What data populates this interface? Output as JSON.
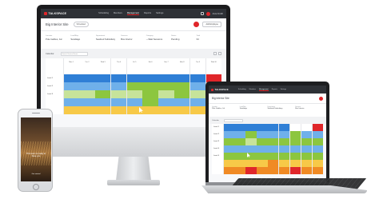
{
  "brand": {
    "accent": "#e0262a",
    "dark": "#2e3136",
    "logo_text": "TALKSPACE"
  },
  "imac": {
    "topbar": {
      "nav": [
        "Scheduling",
        "Members",
        "Management",
        "Reports",
        "Settings"
      ],
      "user": "Anna Smith"
    },
    "title": "Big Interior Site",
    "pill": "Scheduled",
    "cta_label": "Add Employee",
    "metrics": [
      {
        "label": "Location",
        "value": "Pole Gables, Jal"
      },
      {
        "label": "Lead/Rep",
        "value": "Sandiago"
      },
      {
        "label": "Department",
        "value": "Seafood Subsidiary"
      },
      {
        "label": "Services",
        "value": "Bus Interior"
      },
      {
        "label": "Category",
        "value": "—Wait Sessions"
      },
      {
        "label": "Status",
        "value": "Pending"
      },
      {
        "label": "Total",
        "value": "34"
      }
    ],
    "filter_label": "Calendar",
    "filter_placeholder": "Search Service Name",
    "columns": [
      "Mon 1",
      "Tue 2",
      "Wed 3",
      "Thu 4",
      "Fri 5",
      "Sat 6",
      "Sun 7",
      "Mon 8",
      "Tue 9",
      "Wed 10"
    ],
    "rows": [
      {
        "label": "",
        "cells": [
          "w",
          "w",
          "w",
          "w",
          "w",
          "w",
          "w",
          "w",
          "w",
          "w"
        ]
      },
      {
        "label": "Level 1",
        "cells": [
          "b",
          "b",
          "b",
          "b",
          "b",
          "b",
          "b",
          "b",
          "b",
          "r"
        ]
      },
      {
        "label": "Level 2",
        "cells": [
          "lb",
          "lb",
          "lb",
          "lb",
          "g",
          "g",
          "g",
          "g",
          "lb",
          "gr"
        ]
      },
      {
        "label": "Level 3",
        "cells": [
          "lg",
          "lg",
          "g",
          "lg",
          "lg",
          "g",
          "lg",
          "g",
          "lg",
          "lg"
        ]
      },
      {
        "label": "",
        "cells": [
          "lb",
          "lb",
          "lb",
          "lb",
          "lb",
          "g",
          "lb",
          "lb",
          "lb",
          "lb"
        ]
      },
      {
        "label": "",
        "cells": [
          "y",
          "y",
          "y",
          "y",
          "y",
          "y",
          "y",
          "y",
          "y",
          "y"
        ]
      }
    ]
  },
  "laptop": {
    "topbar": {
      "nav": [
        "Scheduling",
        "Members",
        "Management",
        "Reports",
        "Settings"
      ]
    },
    "title": "Big Interior Site",
    "metrics": [
      {
        "label": "Location",
        "value": "Pole Gables, Jal"
      },
      {
        "label": "Lead/Rep",
        "value": "Sandiago"
      },
      {
        "label": "Department",
        "value": "Seafood Subsidiary"
      },
      {
        "label": "Services",
        "value": "Bus Interior"
      }
    ],
    "filter_label": "Calendar",
    "rows": [
      {
        "label": "Level 1",
        "cells": [
          "b",
          "b",
          "b",
          "b",
          "b",
          "b",
          "w",
          "w",
          "r"
        ]
      },
      {
        "label": "Level 2",
        "cells": [
          "lb",
          "lb",
          "g",
          "lb",
          "lb",
          "lb",
          "g",
          "lb",
          "lb"
        ]
      },
      {
        "label": "Level 3",
        "cells": [
          "g",
          "g",
          "lg",
          "g",
          "g",
          "g",
          "g",
          "g",
          "g"
        ]
      },
      {
        "label": "Level 4",
        "cells": [
          "lb",
          "lb",
          "lb",
          "lb",
          "lb",
          "lb",
          "lb",
          "lb",
          "lb"
        ]
      },
      {
        "label": "Level 5",
        "cells": [
          "g",
          "g",
          "g",
          "g",
          "g",
          "g",
          "g",
          "g",
          "g"
        ]
      },
      {
        "label": "",
        "cells": [
          "y",
          "y",
          "y",
          "y",
          "o",
          "y",
          "y",
          "y",
          "y"
        ]
      },
      {
        "label": "",
        "cells": [
          "o",
          "o",
          "r",
          "o",
          "o",
          "o",
          "r",
          "o",
          "o"
        ]
      }
    ]
  },
  "phone": {
    "headline": "This team is ready to have you",
    "link": "Get started"
  }
}
